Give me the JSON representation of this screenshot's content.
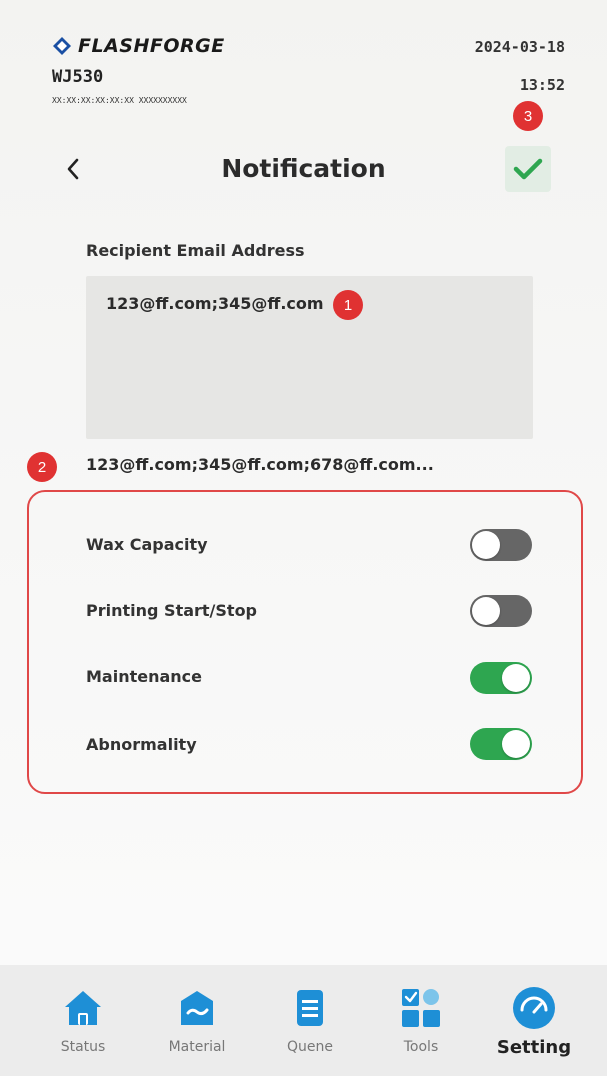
{
  "header": {
    "brand": "FLASHFORGE",
    "model": "WJ530",
    "serial": "XX:XX:XX:XX:XX:XX  XXXXXXXXXX",
    "date": "2024-03-18",
    "time": "13:52"
  },
  "page": {
    "title": "Notification"
  },
  "email": {
    "label": "Recipient Email Address",
    "value": "123@ff.com;345@ff.com",
    "saved_list": "123@ff.com;345@ff.com;678@ff.com..."
  },
  "options": [
    {
      "label": "Wax Capacity",
      "enabled": false
    },
    {
      "label": "Printing Start/Stop",
      "enabled": false
    },
    {
      "label": "Maintenance",
      "enabled": true
    },
    {
      "label": "Abnormality",
      "enabled": true
    }
  ],
  "callouts": {
    "one": "1",
    "two": "2",
    "three": "3"
  },
  "nav": {
    "items": [
      {
        "label": "Status",
        "icon": "home-icon"
      },
      {
        "label": "Material",
        "icon": "material-icon"
      },
      {
        "label": "Quene",
        "icon": "queue-icon"
      },
      {
        "label": "Tools",
        "icon": "tools-icon"
      },
      {
        "label": "Setting",
        "icon": "setting-icon",
        "active": true
      }
    ]
  },
  "colors": {
    "accent": "#2ea650",
    "icon_blue": "#1e8fd6",
    "callout_red": "#e03232"
  }
}
